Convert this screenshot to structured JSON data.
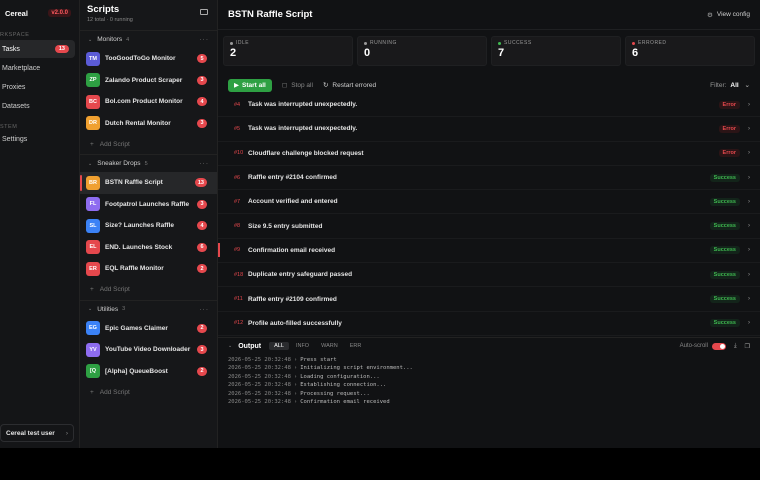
{
  "nav": {
    "app_name": "Cereal",
    "version": "v2.0.0",
    "section_workspace": "RKSPACE",
    "items_workspace": [
      {
        "label": "Tasks",
        "badge": "13",
        "active": true
      },
      {
        "label": "Marketplace"
      },
      {
        "label": "Proxies"
      },
      {
        "label": "Datasets"
      }
    ],
    "section_system": "STEM",
    "items_system": [
      {
        "label": "Settings"
      }
    ],
    "user": "Cereal test user",
    "user_chevron": "›"
  },
  "scripts": {
    "title": "Scripts",
    "subtitle": "12 total · 0 running",
    "groups": [
      {
        "name": "Monitors",
        "count": "4",
        "items": [
          {
            "initials": "TM",
            "color": "#5b5bd6",
            "name": "TooGoodToGo Monitor",
            "badge": "5"
          },
          {
            "initials": "ZP",
            "color": "#2ea043",
            "name": "Zalando Product Scraper",
            "badge": "3"
          },
          {
            "initials": "BC",
            "color": "#e5484d",
            "name": "Bol.com Product Monitor",
            "badge": "4"
          },
          {
            "initials": "DR",
            "color": "#f0a030",
            "name": "Dutch Rental Monitor",
            "badge": "3"
          }
        ],
        "add_label": "Add Script"
      },
      {
        "name": "Sneaker Drops",
        "count": "5",
        "items": [
          {
            "initials": "BR",
            "color": "#f0a030",
            "name": "BSTN Raffle Script",
            "badge": "13",
            "active": true
          },
          {
            "initials": "FL",
            "color": "#8e6cf0",
            "name": "Footpatrol Launches Raffle",
            "badge": "3"
          },
          {
            "initials": "SL",
            "color": "#3b82f6",
            "name": "Size? Launches Raffle",
            "badge": "4"
          },
          {
            "initials": "EL",
            "color": "#e5484d",
            "name": "END. Launches Stock",
            "badge": "6"
          },
          {
            "initials": "ER",
            "color": "#e5484d",
            "name": "EQL Raffle Monitor",
            "badge": "2"
          }
        ],
        "add_label": "Add Script"
      },
      {
        "name": "Utilities",
        "count": "3",
        "items": [
          {
            "initials": "EG",
            "color": "#3b82f6",
            "name": "Epic Games Claimer",
            "badge": "2"
          },
          {
            "initials": "YV",
            "color": "#8e6cf0",
            "name": "YouTube Video Downloader",
            "badge": "3"
          },
          {
            "initials": "[Q",
            "color": "#2ea043",
            "name": "[Alpha] QueueBoost",
            "badge": "2"
          }
        ],
        "add_label": "Add Script"
      }
    ]
  },
  "main": {
    "title": "BSTN Raffle Script",
    "view_config": "View config",
    "stats": [
      {
        "label": "IDLE",
        "value": "2",
        "color": "#999999"
      },
      {
        "label": "RUNNING",
        "value": "0",
        "color": "#999999"
      },
      {
        "label": "SUCCESS",
        "value": "7",
        "color": "#3fb950"
      },
      {
        "label": "ERRORED",
        "value": "6",
        "color": "#e5484d"
      }
    ],
    "toolbar": {
      "start_all": "Start all",
      "stop_all": "Stop all",
      "restart_errored": "Restart errored",
      "filter_label": "Filter:",
      "filter_value": "All"
    },
    "rows": [
      {
        "id": "#4",
        "text": "Task was interrupted unexpectedly.",
        "status": "Error"
      },
      {
        "id": "#5",
        "text": "Task was interrupted unexpectedly.",
        "status": "Error"
      },
      {
        "id": "#10",
        "text": "Cloudflare challenge blocked request",
        "status": "Error"
      },
      {
        "id": "#6",
        "text": "Raffle entry #2104 confirmed",
        "status": "Success"
      },
      {
        "id": "#7",
        "text": "Account verified and entered",
        "status": "Success"
      },
      {
        "id": "#8",
        "text": "Size 9.5 entry submitted",
        "status": "Success"
      },
      {
        "id": "#9",
        "text": "Confirmation email received",
        "status": "Success"
      },
      {
        "id": "#18",
        "text": "Duplicate entry safeguard passed",
        "status": "Success"
      },
      {
        "id": "#11",
        "text": "Raffle entry #2109 confirmed",
        "status": "Success"
      },
      {
        "id": "#12",
        "text": "Profile auto-filled successfully",
        "status": "Success"
      }
    ]
  },
  "output": {
    "title": "Output",
    "tabs": [
      "ALL",
      "INFO",
      "WARN",
      "ERR"
    ],
    "autoscroll_label": "Auto-scroll",
    "logs": [
      {
        "ts": "2026-05-25 20:32:48",
        "msg": "Press start"
      },
      {
        "ts": "2026-05-25 20:32:48",
        "msg": "Initializing script environment..."
      },
      {
        "ts": "2026-05-25 20:32:48",
        "msg": "Loading configuration..."
      },
      {
        "ts": "2026-05-25 20:32:48",
        "msg": "Establishing connection..."
      },
      {
        "ts": "2026-05-25 20:32:48",
        "msg": "Processing request..."
      },
      {
        "ts": "2026-05-25 20:32:48",
        "msg": "Confirmation email received"
      }
    ]
  }
}
